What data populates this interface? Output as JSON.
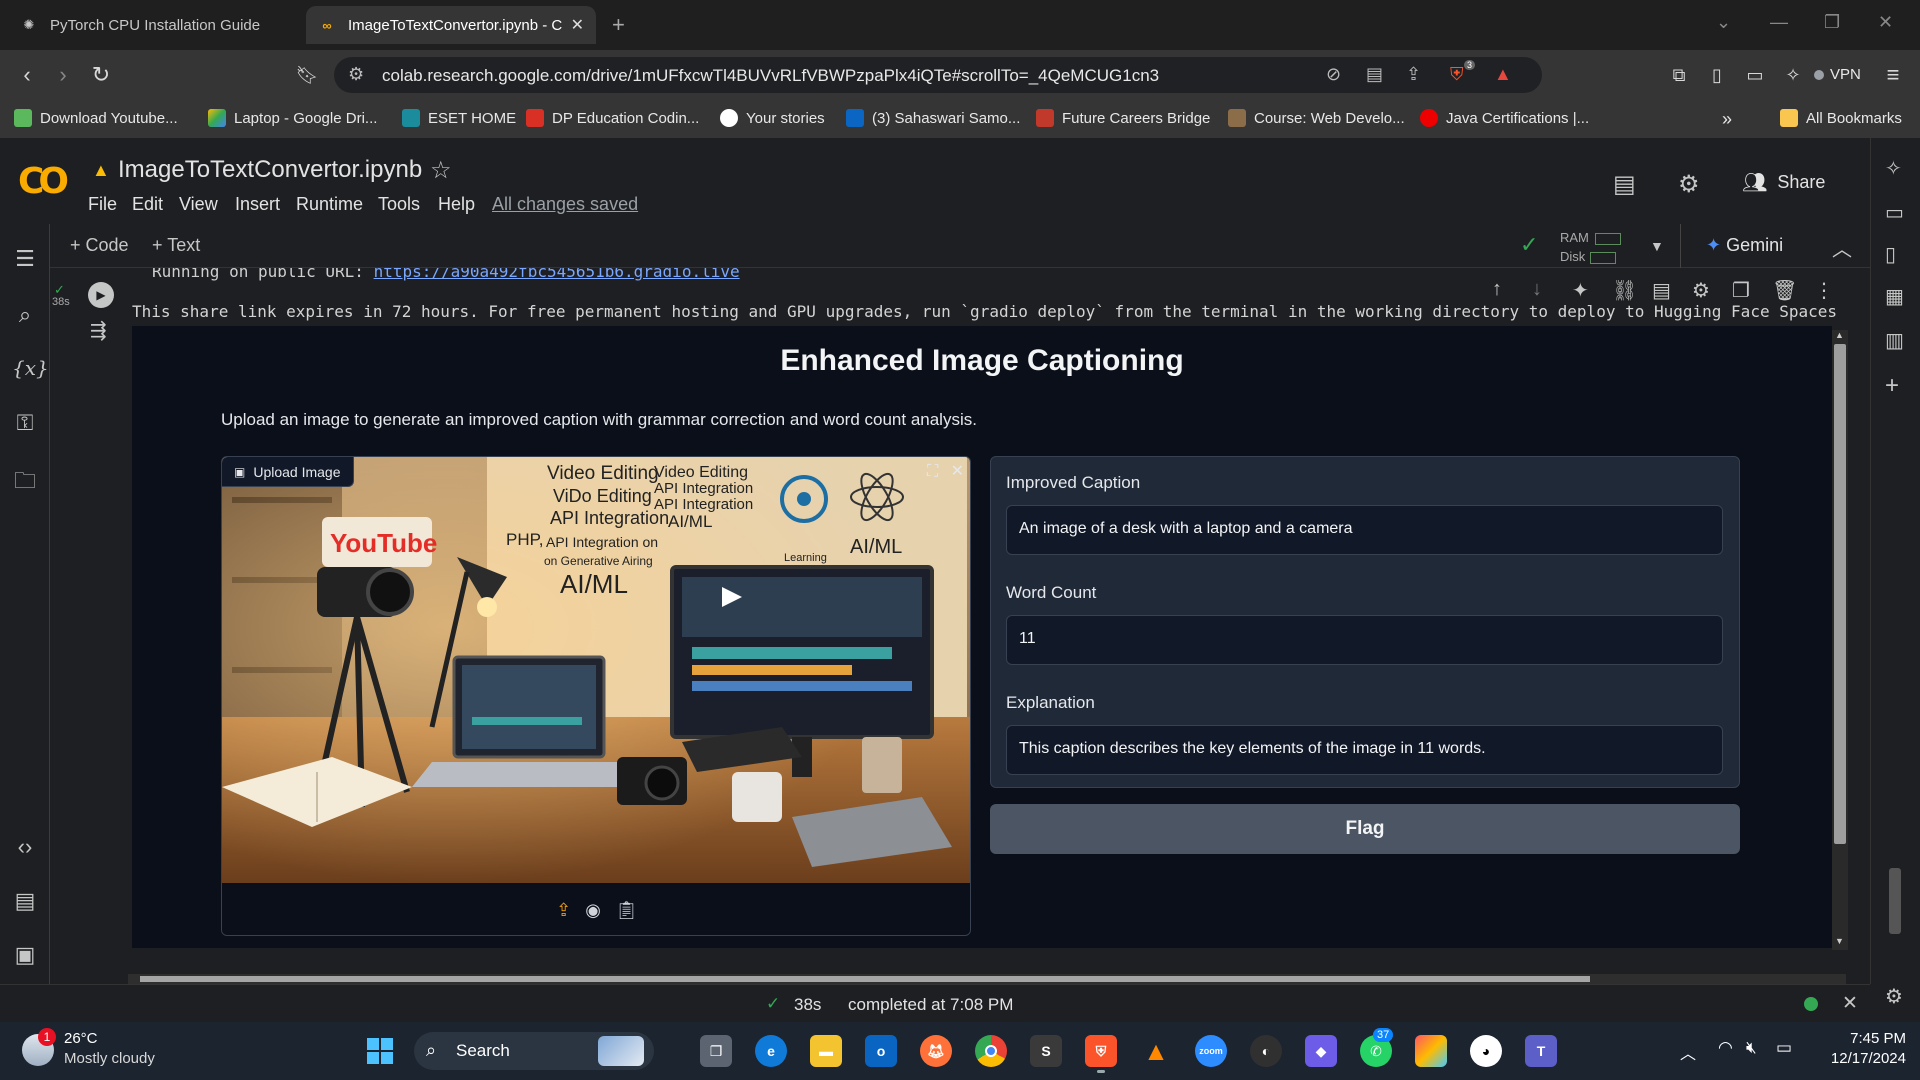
{
  "browser": {
    "tabs": [
      {
        "title": "PyTorch CPU Installation Guide",
        "active": false
      },
      {
        "title": "ImageToTextConvertor.ipynb - C",
        "active": true
      }
    ],
    "url": "colab.research.google.com/drive/1mUFfxcwTl4BUVvRLfVBWPzpaPlx4iQTe#scrollTo=_4QeMCUG1cn3",
    "vpn_label": "VPN",
    "extension_badge": "3",
    "bookmarks": [
      "Download Youtube...",
      "Laptop - Google Dri...",
      "ESET HOME",
      "DP Education Codin...",
      "Your stories",
      "(3) Sahaswari Samo...",
      "Future Careers Bridge",
      "Course: Web Develo...",
      "Java Certifications |..."
    ],
    "all_bookmarks_label": "All Bookmarks"
  },
  "colab": {
    "notebook_title": "ImageToTextConvertor.ipynb",
    "menu": [
      "File",
      "Edit",
      "View",
      "Insert",
      "Runtime",
      "Tools",
      "Help"
    ],
    "save_status": "All changes saved",
    "share_label": "Share",
    "add_code_label": "+ Code",
    "add_text_label": "+ Text",
    "ram_label": "RAM",
    "disk_label": "Disk",
    "gemini_label": "Gemini",
    "exec_time": "38s",
    "status_time": "38s",
    "status_text": "completed at 7:08 PM"
  },
  "output": {
    "prev_line_prefix": "Running on public URL:",
    "prev_line_url": "https://a90a492fbc545651b6.gradio.live",
    "share_notice": "This share link expires in 72 hours. For free permanent hosting and GPU upgrades, run `gradio deploy` from the terminal in the working directory to deploy to Hugging Face Spaces"
  },
  "gradio": {
    "title": "Enhanced Image Captioning",
    "description": "Upload an image to generate an improved caption with grammar correction and word count analysis.",
    "upload_label": "Upload Image",
    "image_texts": [
      "Video Editing",
      "ViDo Editing",
      "API Integration",
      "PHP,",
      "API Integration on",
      "on Generative Airing",
      "AI/ML",
      "Video Editing",
      "API Integration",
      "API Integration",
      "AI/ML",
      "Learning",
      "AI/ML",
      "YouTube"
    ],
    "fields": [
      {
        "label": "Improved Caption",
        "value": "An image of a desk with a laptop and a camera"
      },
      {
        "label": "Word Count",
        "value": "11"
      },
      {
        "label": "Explanation",
        "value": "This caption describes the key elements of the image in 11 words."
      }
    ],
    "flag_label": "Flag"
  },
  "taskbar": {
    "weather_temp": "26°C",
    "weather_desc": "Mostly cloudy",
    "weather_badge": "1",
    "search_label": "Search",
    "whatsapp_badge": "37",
    "time": "7:45 PM",
    "date": "12/17/2024"
  },
  "colors": {
    "accent_orange": "#f9ab00",
    "gradio_bg": "#0b0f19",
    "panel_bg": "#1f2937",
    "flag_bg": "#4b5563",
    "success_green": "#34a853"
  }
}
